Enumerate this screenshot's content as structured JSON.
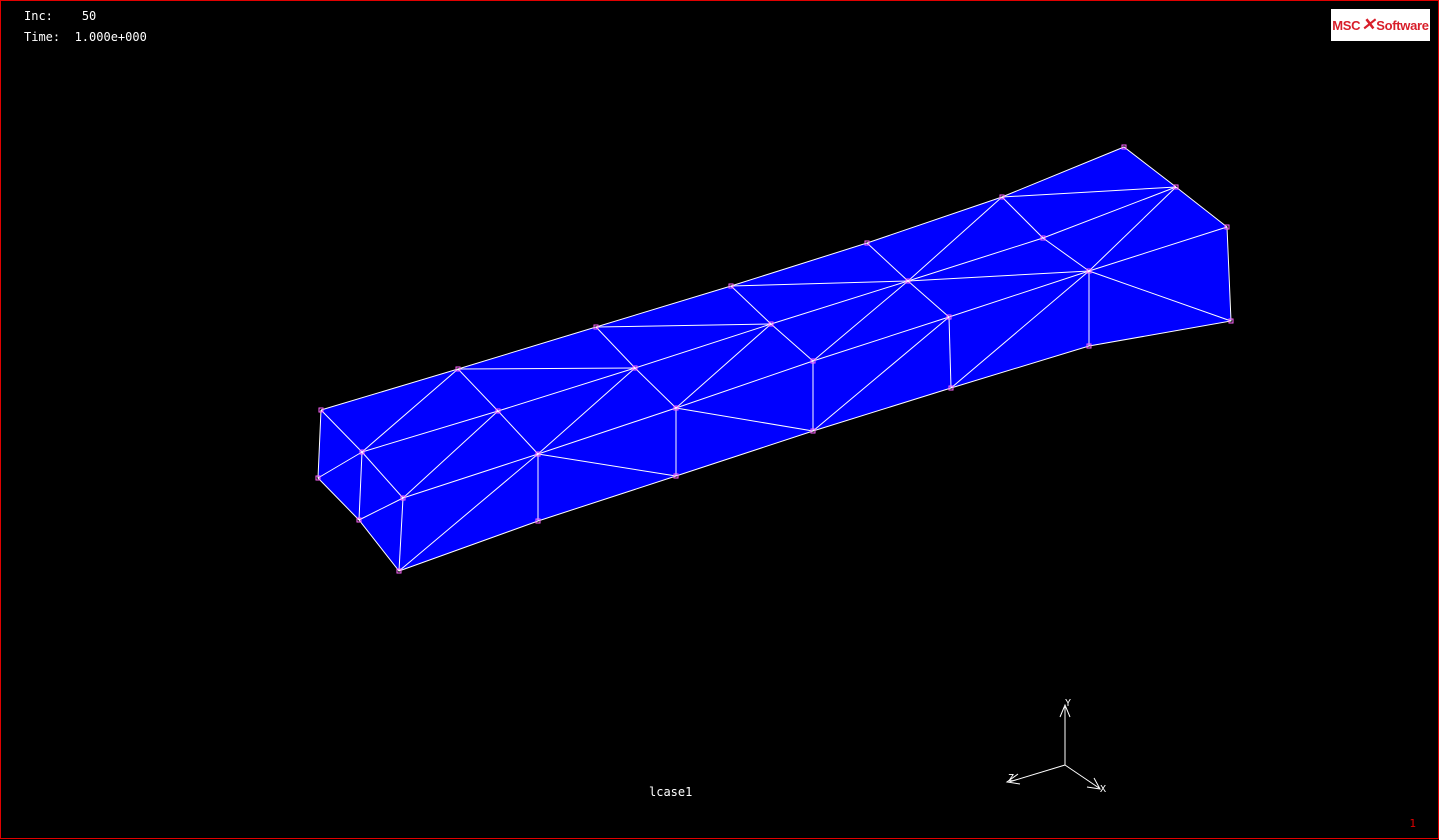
{
  "hud": {
    "inc_label": "Inc:",
    "inc_value": "50",
    "time_label": "Time:",
    "time_value": "1.000e+000"
  },
  "logo": {
    "left": "MSC",
    "right": "Software"
  },
  "loadcase": "lcase1",
  "axes": {
    "y": "Y",
    "z": "Z",
    "x": "X"
  },
  "page_number": "1",
  "colors": {
    "background": "#000000",
    "border": "#e00000",
    "mesh_fill": "#0000ff",
    "mesh_edges": "#ffffff",
    "node_marker": "#ff66ff"
  },
  "mesh": {
    "element_type": "triangles",
    "fill": "solid"
  }
}
